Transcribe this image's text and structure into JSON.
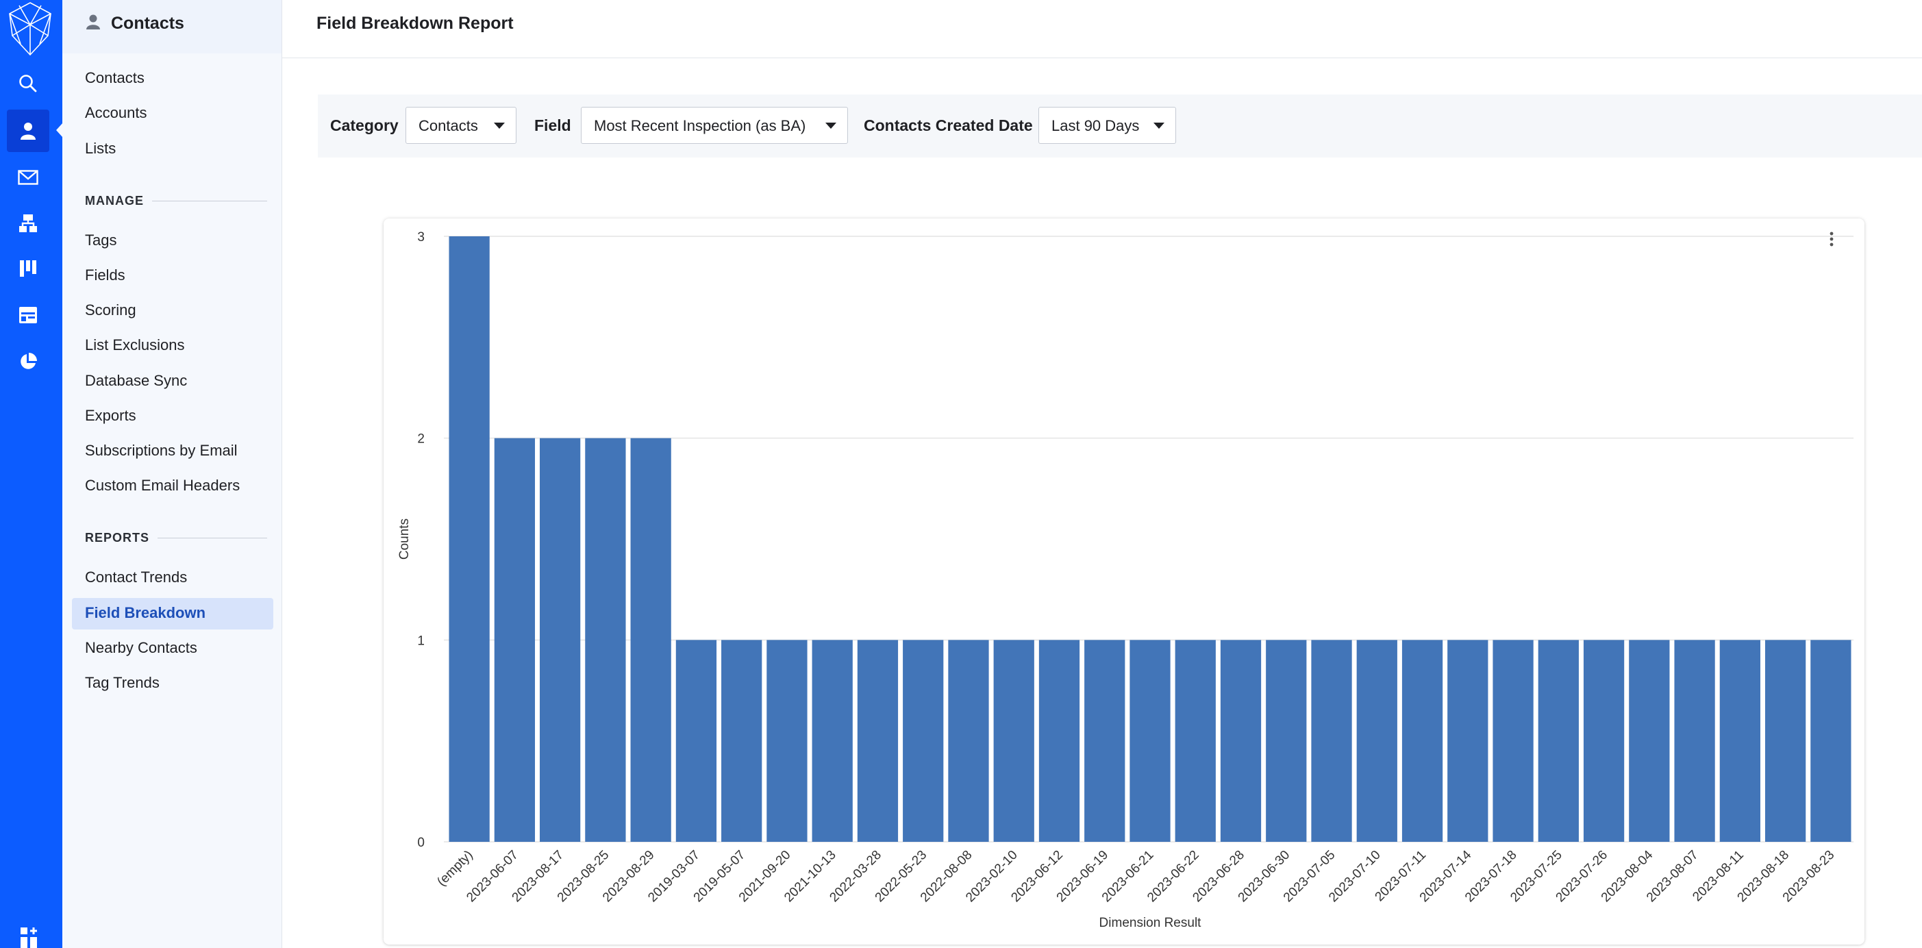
{
  "app": {
    "sidebar_title": "Contacts",
    "page_title": "Field Breakdown Report",
    "accent": "#0c5cff"
  },
  "rail": {
    "icons": [
      "logo-icon",
      "search-icon",
      "contacts-icon",
      "email-icon",
      "automations-icon",
      "deals-icon",
      "websites-icon",
      "reports-icon",
      "apps-icon"
    ],
    "active": "contacts-icon"
  },
  "sidebar": {
    "top_links": [
      "Contacts",
      "Accounts",
      "Lists"
    ],
    "manage_header": "MANAGE",
    "manage_links": [
      "Tags",
      "Fields",
      "Scoring",
      "List Exclusions",
      "Database Sync",
      "Exports",
      "Subscriptions by Email",
      "Custom Email Headers"
    ],
    "reports_header": "REPORTS",
    "reports_links": [
      "Contact Trends",
      "Field Breakdown",
      "Nearby Contacts",
      "Tag Trends"
    ],
    "active_link": "Field Breakdown"
  },
  "filters": {
    "category_label": "Category",
    "category_value": "Contacts",
    "field_label": "Field",
    "field_value": "Most Recent Inspection (as BA)",
    "date_label": "Contacts Created Date",
    "date_value": "Last 90 Days"
  },
  "chart_data": {
    "type": "bar",
    "xlabel": "Dimension Result",
    "ylabel": "Counts",
    "ylim": [
      0,
      3
    ],
    "yticks": [
      0,
      1,
      2,
      3
    ],
    "color": "#4275b8",
    "categories": [
      "(empty)",
      "2023-06-07",
      "2023-08-17",
      "2023-08-25",
      "2023-08-29",
      "2019-03-07",
      "2019-05-07",
      "2021-09-20",
      "2021-10-13",
      "2022-03-28",
      "2022-05-23",
      "2022-08-08",
      "2023-02-10",
      "2023-06-12",
      "2023-06-19",
      "2023-06-21",
      "2023-06-22",
      "2023-06-28",
      "2023-06-30",
      "2023-07-05",
      "2023-07-10",
      "2023-07-11",
      "2023-07-14",
      "2023-07-18",
      "2023-07-25",
      "2023-07-26",
      "2023-08-04",
      "2023-08-07",
      "2023-08-11",
      "2023-08-18",
      "2023-08-23"
    ],
    "values": [
      3,
      2,
      2,
      2,
      2,
      1,
      1,
      1,
      1,
      1,
      1,
      1,
      1,
      1,
      1,
      1,
      1,
      1,
      1,
      1,
      1,
      1,
      1,
      1,
      1,
      1,
      1,
      1,
      1,
      1,
      1
    ],
    "grid": true
  }
}
